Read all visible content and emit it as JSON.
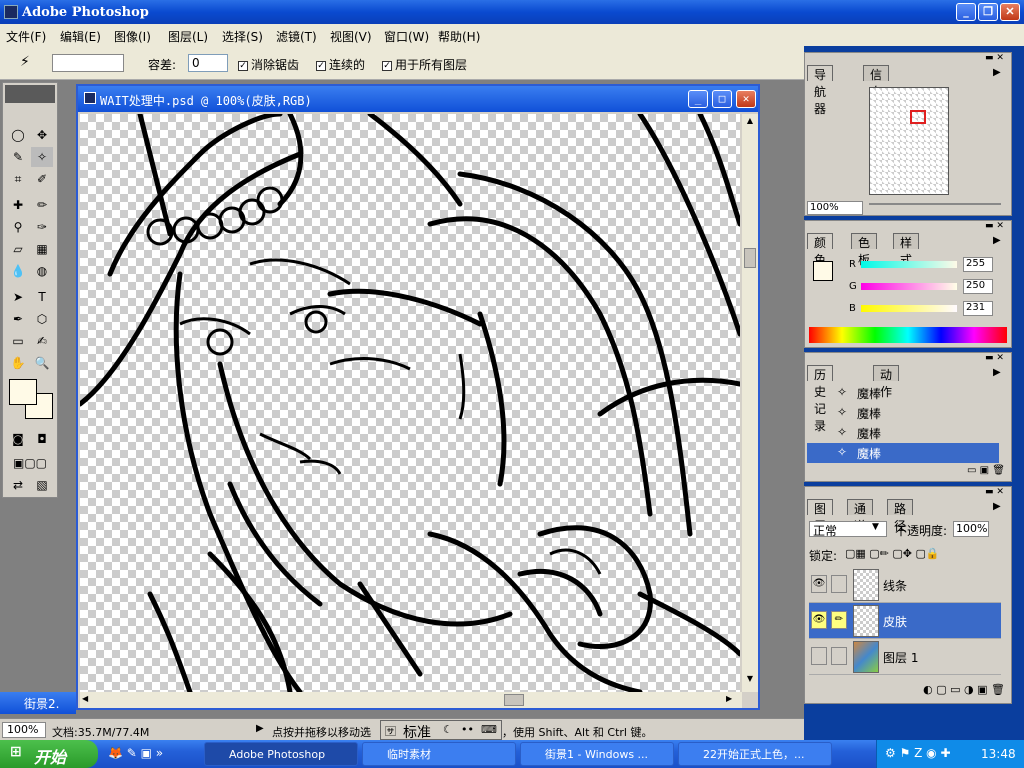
{
  "app": {
    "title": "Adobe Photoshop"
  },
  "menu": [
    "文件(F)",
    "编辑(E)",
    "图像(I)",
    "图层(L)",
    "选择(S)",
    "滤镜(T)",
    "视图(V)",
    "窗口(W)",
    "帮助(H)"
  ],
  "options": {
    "tolerance_label": "容差:",
    "tolerance_value": "0",
    "anti_alias": "消除锯齿",
    "contiguous": "连续的",
    "all_layers": "用于所有图层"
  },
  "document": {
    "title": "WAIT处理中.psd @ 100%(皮肤,RGB)"
  },
  "background_window": {
    "title": "街景2."
  },
  "navigator": {
    "tab1": "导航器",
    "tab2": "信息",
    "zoom": "100%"
  },
  "color": {
    "tab1": "颜色",
    "tab2": "色板",
    "tab3": "样式",
    "r_label": "R",
    "g_label": "G",
    "b_label": "B",
    "r": 255,
    "g": 250,
    "b": 231,
    "fg_hex": "#fffae7"
  },
  "history": {
    "tab1": "历史记录",
    "tab2": "动作",
    "items": [
      "魔棒",
      "魔棒",
      "魔棒",
      "魔棒"
    ]
  },
  "layers": {
    "tab1": "图层",
    "tab2": "通道",
    "tab3": "路径",
    "blend_mode": "正常",
    "opacity_label": "不透明度:",
    "opacity": "100%",
    "lock_label": "锁定:",
    "items": [
      {
        "name": "线条"
      },
      {
        "name": "皮肤"
      },
      {
        "name": "图层 1"
      }
    ]
  },
  "status": {
    "zoom": "100%",
    "doc_info": "文档:35.7M/77.4M",
    "hint_left": "点按并拖移以移动选",
    "ime_label": "标准",
    "hint_right": "，使用 Shift、Alt 和 Ctrl 键。"
  },
  "taskbar": {
    "start": "开始",
    "items": [
      "Adobe Photoshop",
      "临时素材",
      "街景1 - Windows ...",
      "22开始正式上色，..."
    ],
    "clock": "13:48"
  },
  "colors": {
    "xp_blue": "#2c5cd4",
    "selection": "#3a6ac8",
    "layer_highlight": "#ffff80"
  }
}
